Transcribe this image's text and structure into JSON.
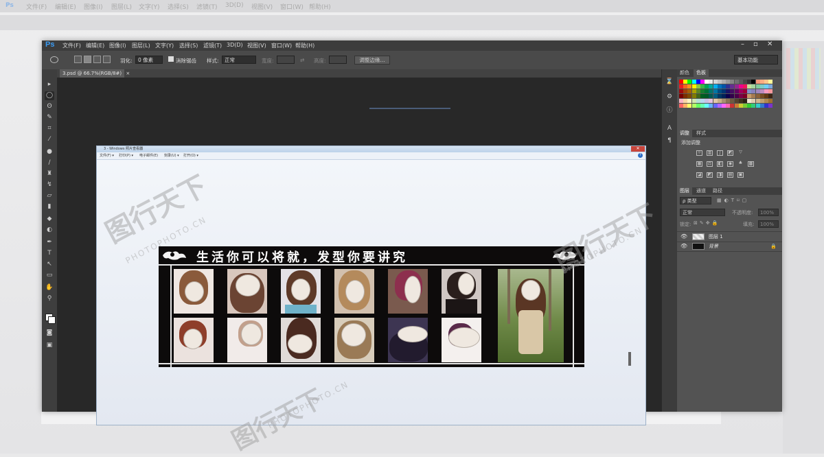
{
  "app": {
    "logo": "Ps",
    "menu": [
      "文件(F)",
      "编辑(E)",
      "图像(I)",
      "图层(L)",
      "文字(Y)",
      "选择(S)",
      "滤镜(T)",
      "3D(D)",
      "视图(V)",
      "窗口(W)",
      "帮助(H)"
    ],
    "window_controls": [
      "–",
      "▫",
      "✕"
    ]
  },
  "options_bar": {
    "feather_label": "羽化:",
    "feather_value": "0 像素",
    "antialias_label": "消除锯齿",
    "style_label": "样式:",
    "style_value": "正常",
    "width_label": "宽度:",
    "height_label": "高度:",
    "refine_button": "调整边缘...",
    "workspace": "基本功能"
  },
  "document": {
    "tab_label": "3.psd @ 66.7%(RGB/8#)",
    "tab_close": "×"
  },
  "viewer": {
    "title": "3 - Windows 照片查看器",
    "menu": [
      "文件(F) ▾",
      "打印(P) ▾",
      "电子邮件(E)",
      "刻录(U) ▾",
      "打开(O) ▾"
    ],
    "help": "?",
    "close": "✕"
  },
  "poster": {
    "banner_text": "生活你可以将就，发型你要讲究"
  },
  "watermarks": {
    "brand": "图行天下",
    "sub": "PHOTOPHOTO.CN"
  },
  "panels": {
    "tabs_top": [
      "颜色",
      "色板"
    ],
    "adjust_tabs": [
      "调整",
      "样式"
    ],
    "adjust_title": "添加调整",
    "layer_tabs": [
      "图层",
      "通道",
      "路径"
    ],
    "kind_label": "ρ 类型",
    "blend_mode": "正常",
    "opacity_label": "不透明度:",
    "opacity_value": "100%",
    "lock_label": "锁定:",
    "fill_label": "填充:",
    "fill_value": "100%",
    "layers": [
      {
        "name": "图层 1",
        "locked": false
      },
      {
        "name": "背景",
        "locked": true
      }
    ]
  },
  "background_ui": {
    "menu": [
      "文件(F)",
      "编辑(E)",
      "图像(I)",
      "图层(L)",
      "文字(Y)",
      "选择(S)",
      "滤镜(T)",
      "3D(D)",
      "视图(V)",
      "窗口(W)",
      "帮助(H)"
    ]
  }
}
